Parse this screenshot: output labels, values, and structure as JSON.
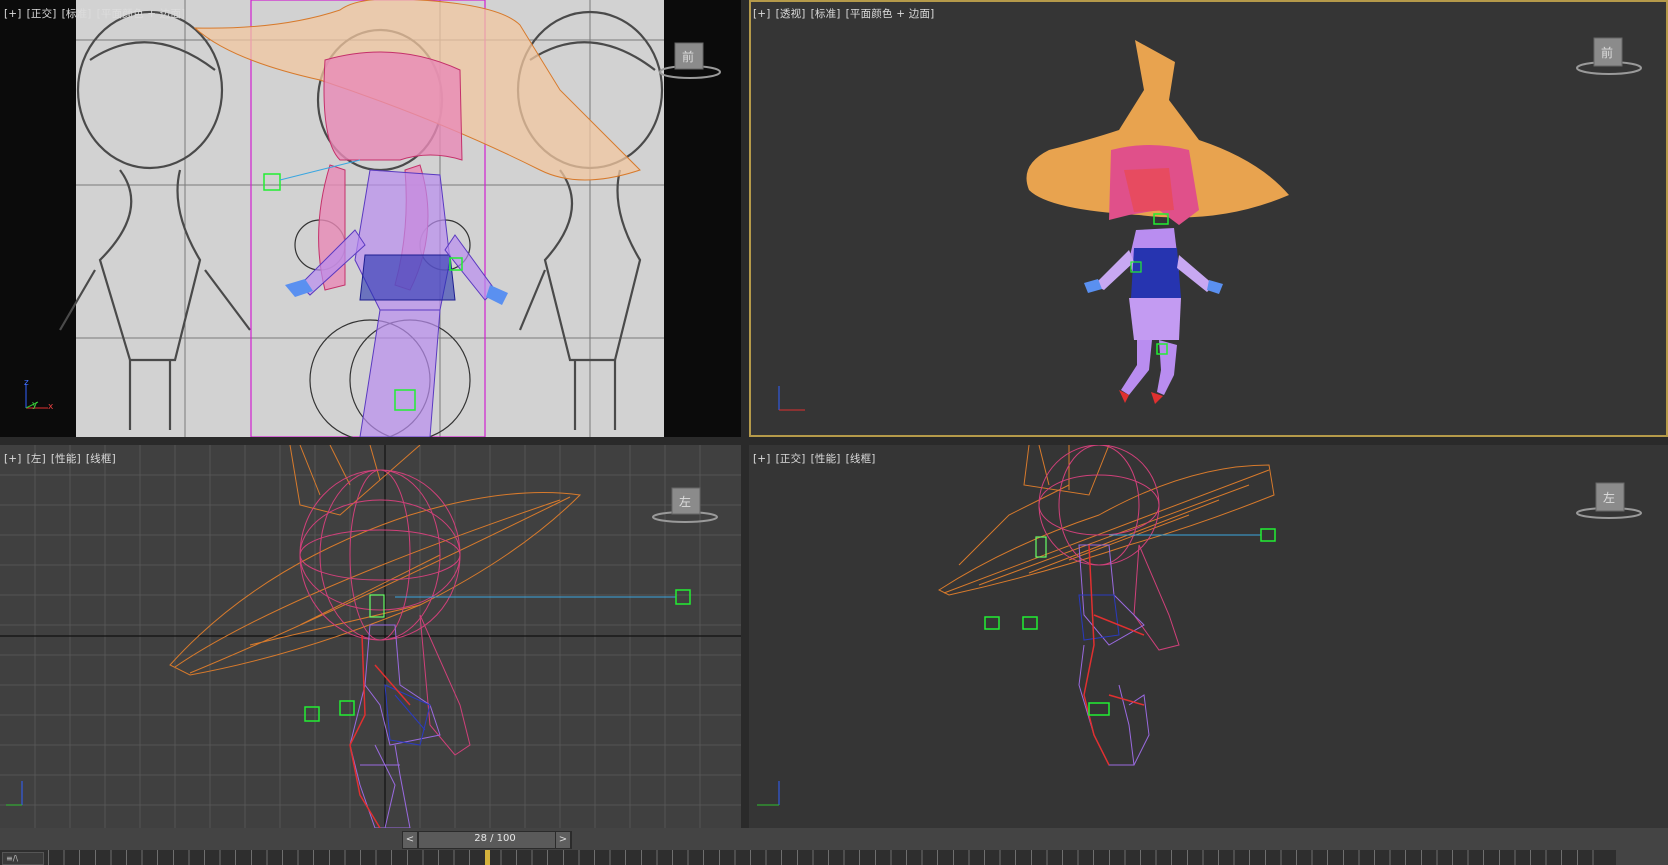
{
  "viewports": [
    {
      "id": "front",
      "labels": [
        "[+]",
        "[正交]",
        "[标准]",
        "[平面颜色 + 边面]"
      ],
      "cube_label": "前",
      "active": false
    },
    {
      "id": "perspective",
      "labels": [
        "[+]",
        "[透视]",
        "[标准]",
        "[平面颜色 + 边面]"
      ],
      "cube_label": "前",
      "active": true
    },
    {
      "id": "left",
      "labels": [
        "[+]",
        "[左]",
        "[性能]",
        "[线框]"
      ],
      "cube_label": "左",
      "active": false
    },
    {
      "id": "ortho",
      "labels": [
        "[+]",
        "[正交]",
        "[性能]",
        "[线框]"
      ],
      "cube_label": "左",
      "active": false
    }
  ],
  "axis_labels": {
    "z": "z",
    "y": "y",
    "x": "x"
  },
  "timeline": {
    "current": "28 / 100",
    "frame": 28,
    "total_frames": 100,
    "prev": "<",
    "next": ">"
  },
  "track_icon": "≡/\\",
  "colors": {
    "active_border": "#b59a4a",
    "hat": "#e8a34f",
    "hair": "#e0508a",
    "body_purple": "#b98df0",
    "dress_blue": "#2634b0",
    "bone_green": "#22ee33",
    "marker_yellow": "#d4b23c"
  }
}
